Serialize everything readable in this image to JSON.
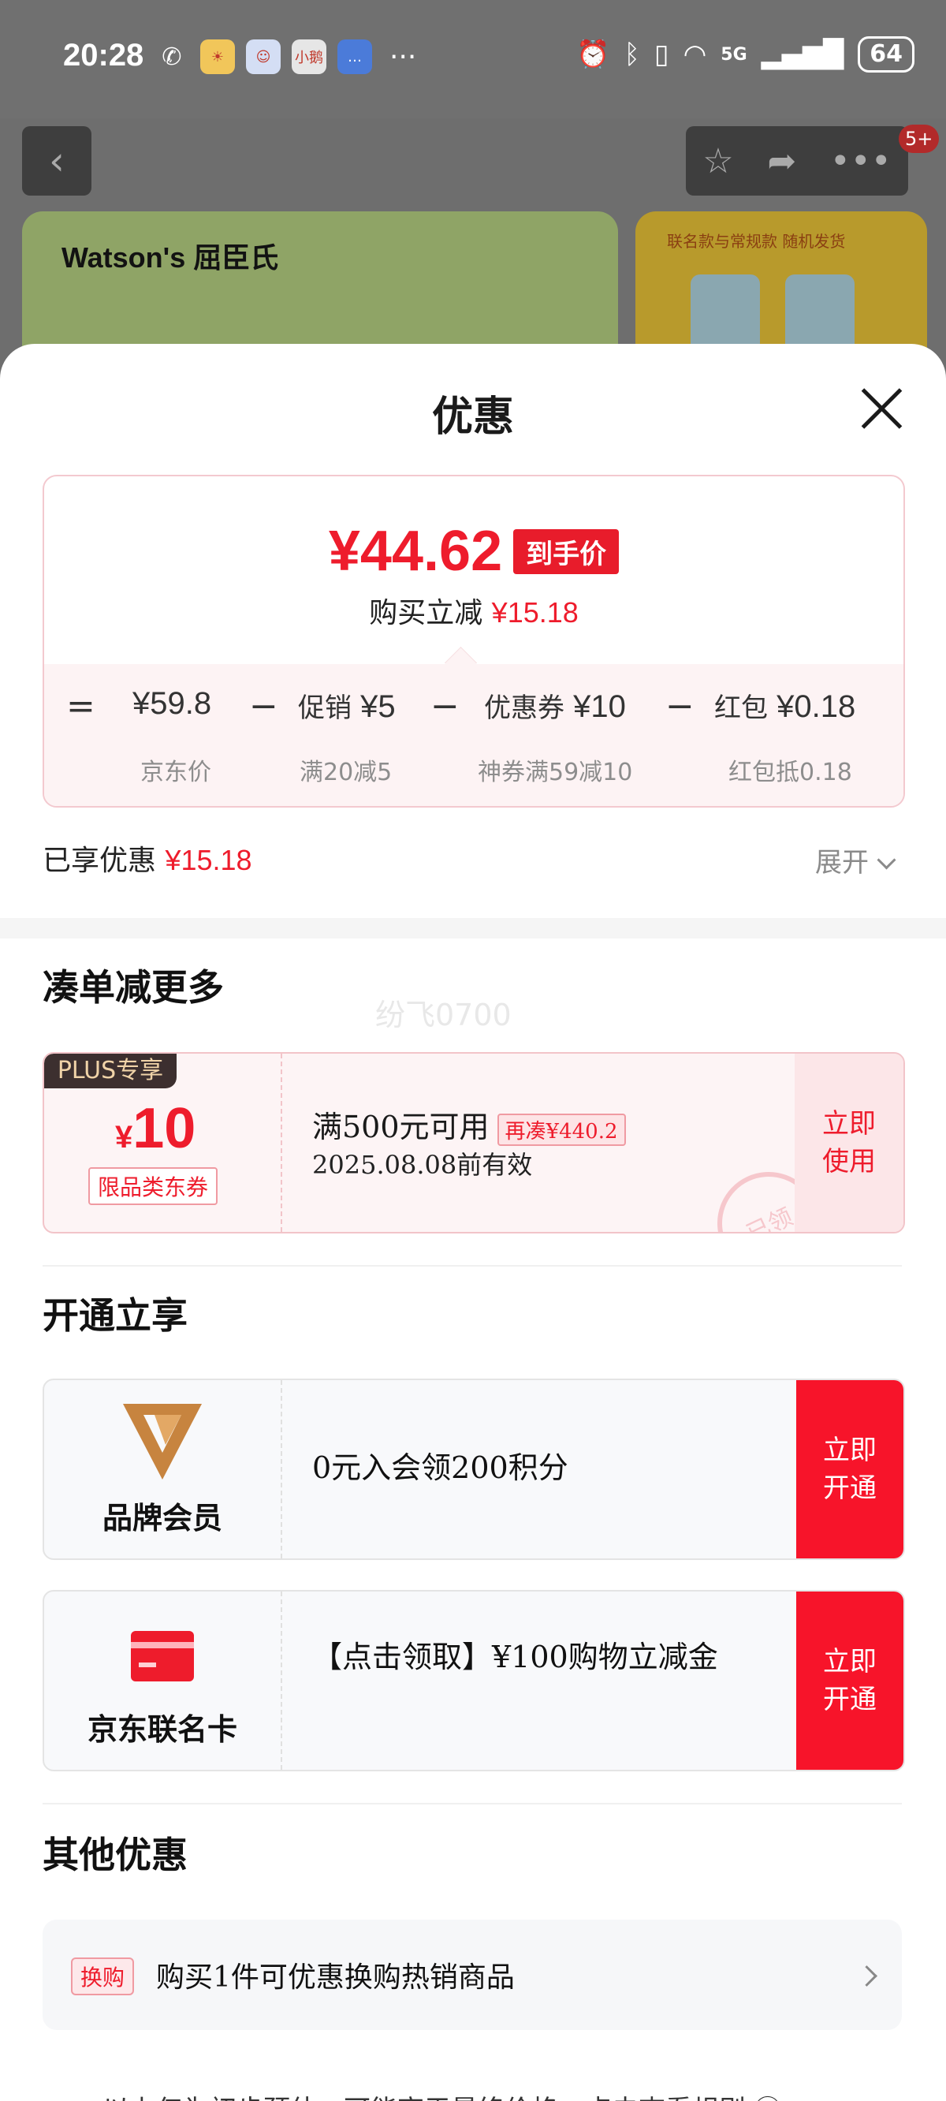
{
  "status_bar": {
    "time": "20:28",
    "app_icons": [
      "weather",
      "assistant",
      "小鹅",
      "messages"
    ],
    "more": "···",
    "network": "5G",
    "battery": "64"
  },
  "background_page": {
    "banner_brand": "Watson's 屈臣氏",
    "banner_right_text": "联名款与常规款 随机发货",
    "badge": "5+"
  },
  "sheet": {
    "title": "优惠",
    "price_card": {
      "final_price": "¥44.62",
      "final_tag": "到手价",
      "saved_label": "购买立减",
      "saved_value": "¥15.18",
      "breakdown": [
        {
          "op": "=",
          "label": "",
          "value": "¥59.8",
          "sub": "京东价"
        },
        {
          "op": "−",
          "label": "促销",
          "value": "¥5",
          "sub": "满20减5"
        },
        {
          "op": "−",
          "label": "优惠券",
          "value": "¥10",
          "sub": "神券满59减10"
        },
        {
          "op": "−",
          "label": "红包",
          "value": "¥0.18",
          "sub": "红包抵0.18"
        }
      ]
    },
    "enjoyed_label": "已享优惠",
    "enjoyed_value": "¥15.18",
    "expand_label": "展开",
    "section_more": "凑单减更多",
    "watermark": "纷飞0700",
    "coupon": {
      "plus_tag": "PLUS专享",
      "currency": "¥",
      "amount": "10",
      "type": "限品类东券",
      "condition": "满500元可用",
      "gap_tag": "再凑¥440.2",
      "valid": "2025.08.08前有效",
      "use_button": "立即使用",
      "stamp": "已领"
    },
    "section_open": "开通立享",
    "member_cards": [
      {
        "name": "品牌会员",
        "text": "0元入会领200积分",
        "button": "立即开通"
      },
      {
        "name": "京东联名卡",
        "text": "【点击领取】¥100购物立减金",
        "button": "立即开通"
      }
    ],
    "section_other": "其他优惠",
    "other": {
      "tag": "换购",
      "text": "购买1件可优惠换购热销商品"
    },
    "footnote": "以上仅为初步预估，可能高于最终价格，点击查看规则 ⓘ"
  },
  "colors": {
    "accent_red": "#ee1c2c",
    "button_red": "#f7142a",
    "plus_bg": "#3c2f2f",
    "brand_gold": "#b0652b"
  }
}
